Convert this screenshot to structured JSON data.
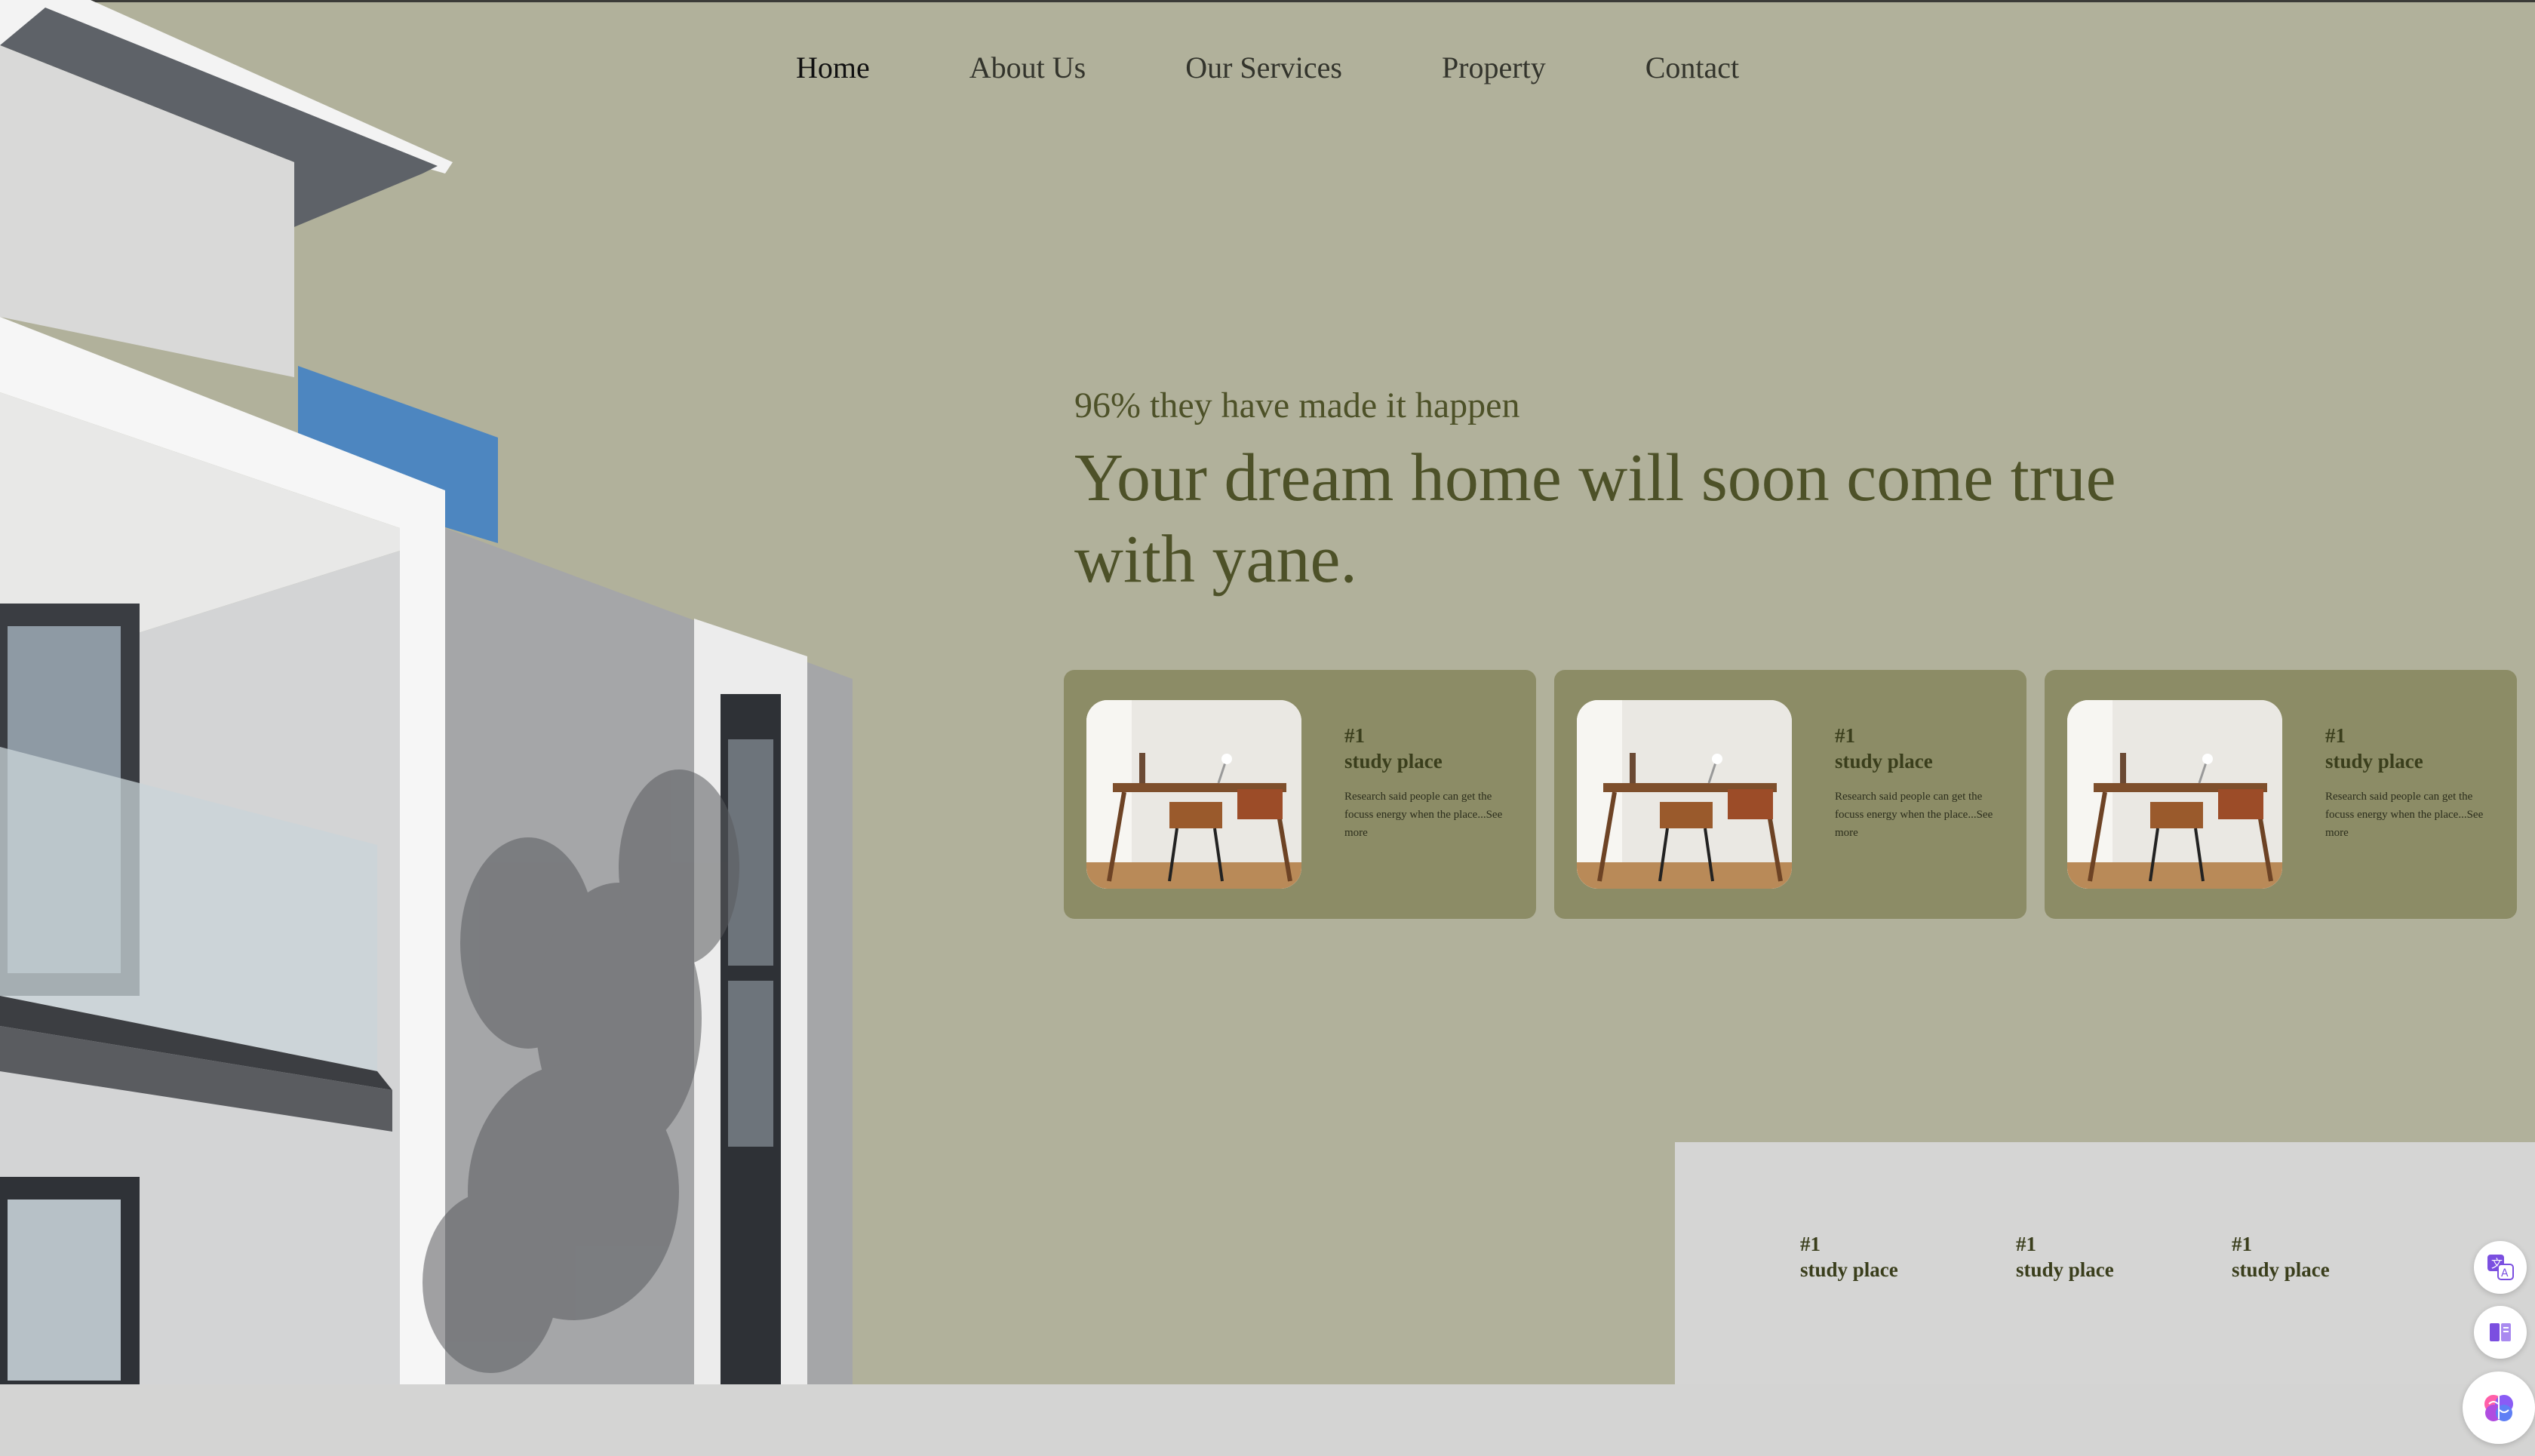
{
  "nav": {
    "items": [
      {
        "label": "Home",
        "active": true
      },
      {
        "label": "About Us"
      },
      {
        "label": "Our Services"
      },
      {
        "label": "Property"
      },
      {
        "label": "Contact"
      }
    ]
  },
  "hero": {
    "eyebrow": "96% they have made it happen",
    "headline": "Your dream home will soon come true with yane."
  },
  "cards": [
    {
      "tag": "#1",
      "title": "study place",
      "desc": "Research said people can get the focuss energy when the place...See more"
    },
    {
      "tag": "#1",
      "title": "study place",
      "desc": "Research said people can get the focuss energy when the place...See more"
    },
    {
      "tag": "#1",
      "title": "study place",
      "desc": "Research said people can get the focuss energy when the place...See more"
    }
  ],
  "panel": {
    "items": [
      {
        "tag": "#1",
        "title": "study place"
      },
      {
        "tag": "#1",
        "title": "study place"
      },
      {
        "tag": "#1",
        "title": "study place"
      }
    ]
  },
  "tools": [
    {
      "icon": "translate-icon"
    },
    {
      "icon": "reader-icon"
    },
    {
      "icon": "brain-icon"
    }
  ],
  "colors": {
    "background": "#b1b19b",
    "card": "#8c8c66",
    "heading": "#4d5128",
    "panel": "#d5d5d4"
  }
}
